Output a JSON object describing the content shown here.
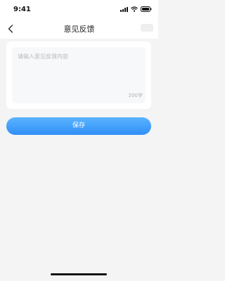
{
  "status_bar": {
    "time": "9:41",
    "icons": [
      "signal-icon",
      "wifi-icon",
      "battery-icon"
    ]
  },
  "header": {
    "title": "意见反馈",
    "back_icon": "chevron-left-icon"
  },
  "feedback": {
    "placeholder": "请输入意见反馈内容",
    "value": "",
    "limit_text": "200字"
  },
  "save_button": {
    "label": "保存"
  },
  "colors": {
    "accent": "#2f8ff7",
    "accent_light": "#5bb4ff",
    "background": "#f4f4f4"
  }
}
